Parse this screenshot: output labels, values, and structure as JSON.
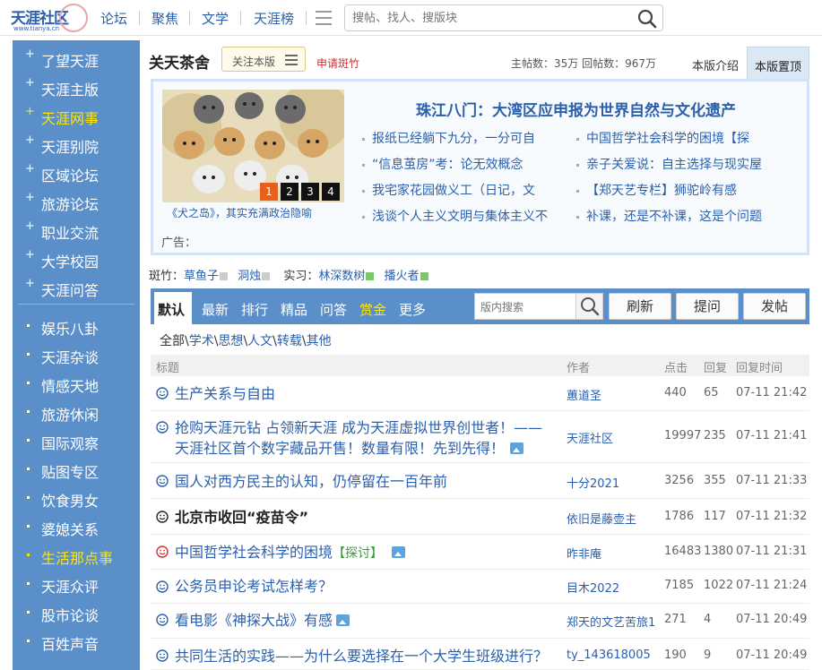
{
  "site": {
    "logo_text": "天涯社区",
    "logo_sub": "www.tianya.cn"
  },
  "nav": [
    "论坛",
    "聚焦",
    "文学",
    "天涯榜"
  ],
  "search": {
    "placeholder": "搜帖、找人、搜版块"
  },
  "sidebar": {
    "group1": [
      {
        "label": "了望天涯",
        "active": false
      },
      {
        "label": "天涯主版",
        "active": false
      },
      {
        "label": "天涯网事",
        "active": true
      },
      {
        "label": "天涯别院",
        "active": false
      },
      {
        "label": "区域论坛",
        "active": false
      },
      {
        "label": "旅游论坛",
        "active": false
      },
      {
        "label": "职业交流",
        "active": false
      },
      {
        "label": "大学校园",
        "active": false
      },
      {
        "label": "天涯问答",
        "active": false
      }
    ],
    "group2": [
      {
        "label": "娱乐八卦",
        "active": false
      },
      {
        "label": "天涯杂谈",
        "active": false
      },
      {
        "label": "情感天地",
        "active": false
      },
      {
        "label": "旅游休闲",
        "active": false
      },
      {
        "label": "国际观察",
        "active": false
      },
      {
        "label": "贴图专区",
        "active": false
      },
      {
        "label": "饮食男女",
        "active": false
      },
      {
        "label": "婆媳关系",
        "active": false
      },
      {
        "label": "生活那点事",
        "active": true
      },
      {
        "label": "天涯众评",
        "active": false
      },
      {
        "label": "股市论谈",
        "active": false
      },
      {
        "label": "百姓声音",
        "active": false
      }
    ]
  },
  "board": {
    "title": "关天茶舍",
    "follow_label": "关注本版",
    "apply_label": "申请斑竹",
    "stats": "主帖数：35万 回帖数：967万",
    "tab_intro": "本版介绍",
    "tab_top": "本版置顶"
  },
  "feature": {
    "caption": "《犬之岛》，其实充满政治隐喻",
    "pages": [
      "1",
      "2",
      "3",
      "4"
    ],
    "headline": "珠江八门：大湾区应申报为世界自然与文化遗产",
    "links_left": [
      "报纸已经躺下九分，一分可自",
      "“信息茧房”考：论无效概念",
      "我宅家花园做义工（日记，文",
      "浅谈个人主义文明与集体主义不"
    ],
    "links_right": [
      "中国哲学社会科学的困境【探",
      "亲子关爱说：自主选择与现实屋",
      "【郑天艺专栏】狮驼岭有感",
      "补课，还是不补课，这是个问题"
    ],
    "ad_label": "广告："
  },
  "moderators": {
    "label_main": "斑竹：",
    "main": [
      "草鱼子",
      "洞烛"
    ],
    "label_intern": "实习：",
    "intern": [
      "林深数树",
      "播火者"
    ]
  },
  "filter": {
    "tabs": [
      "默认",
      "最新",
      "排行",
      "精品",
      "问答",
      "赏金",
      "更多"
    ],
    "search_placeholder": "版内搜索",
    "btn_refresh": "刷新",
    "btn_ask": "提问",
    "btn_post": "发帖"
  },
  "categories": [
    "全部",
    "学术",
    "思想",
    "人文",
    "转载",
    "其他"
  ],
  "table": {
    "headers": {
      "title": "标题",
      "author": "作者",
      "clicks": "点击",
      "replies": "回复",
      "time": "回复时间"
    },
    "rows": [
      {
        "title": "生产关系与自由",
        "author": "蕙道圣",
        "clicks": "440",
        "replies": "65",
        "time": "07-11 21:42"
      },
      {
        "title": "抢购天涯元钻 占领新天涯 成为天涯虚拟世界创世者！——",
        "title2": "天涯社区首个数字藏品开售！数量有限！先到先得！",
        "author": "天涯社区",
        "clicks": "19997",
        "replies": "235",
        "time": "07-11 21:41"
      },
      {
        "title": "国人对西方民主的认知，仍停留在一百年前",
        "author": "十分2021",
        "clicks": "3256",
        "replies": "355",
        "time": "07-11 21:33"
      },
      {
        "title": "北京市收回“疫苗令”",
        "author": "依旧是藤壶主",
        "clicks": "1786",
        "replies": "117",
        "time": "07-11 21:32"
      },
      {
        "title": "中国哲学社会科学的困境",
        "tag": "【探讨】",
        "author": "昨非庵",
        "clicks": "16483",
        "replies": "1380",
        "time": "07-11 21:31"
      },
      {
        "title": "公务员申论考试怎样考？",
        "author": "目木2022",
        "clicks": "7185",
        "replies": "1022",
        "time": "07-11 21:24"
      },
      {
        "title": "看电影《神探大战》有感",
        "author": "郑天的文艺苦旅1",
        "clicks": "271",
        "replies": "4",
        "time": "07-11 20:49"
      },
      {
        "title": "共同生活的实践——为什么要选择在一个大学生班级进行？",
        "author": "ty_143618005",
        "clicks": "190",
        "replies": "9",
        "time": "07-11 20:49"
      }
    ]
  },
  "colors": {
    "brand_blue": "#2a5fad",
    "sidebar_bg": "#5b8fc9",
    "highlight": "#ffe600",
    "orange": "#e8601c"
  }
}
